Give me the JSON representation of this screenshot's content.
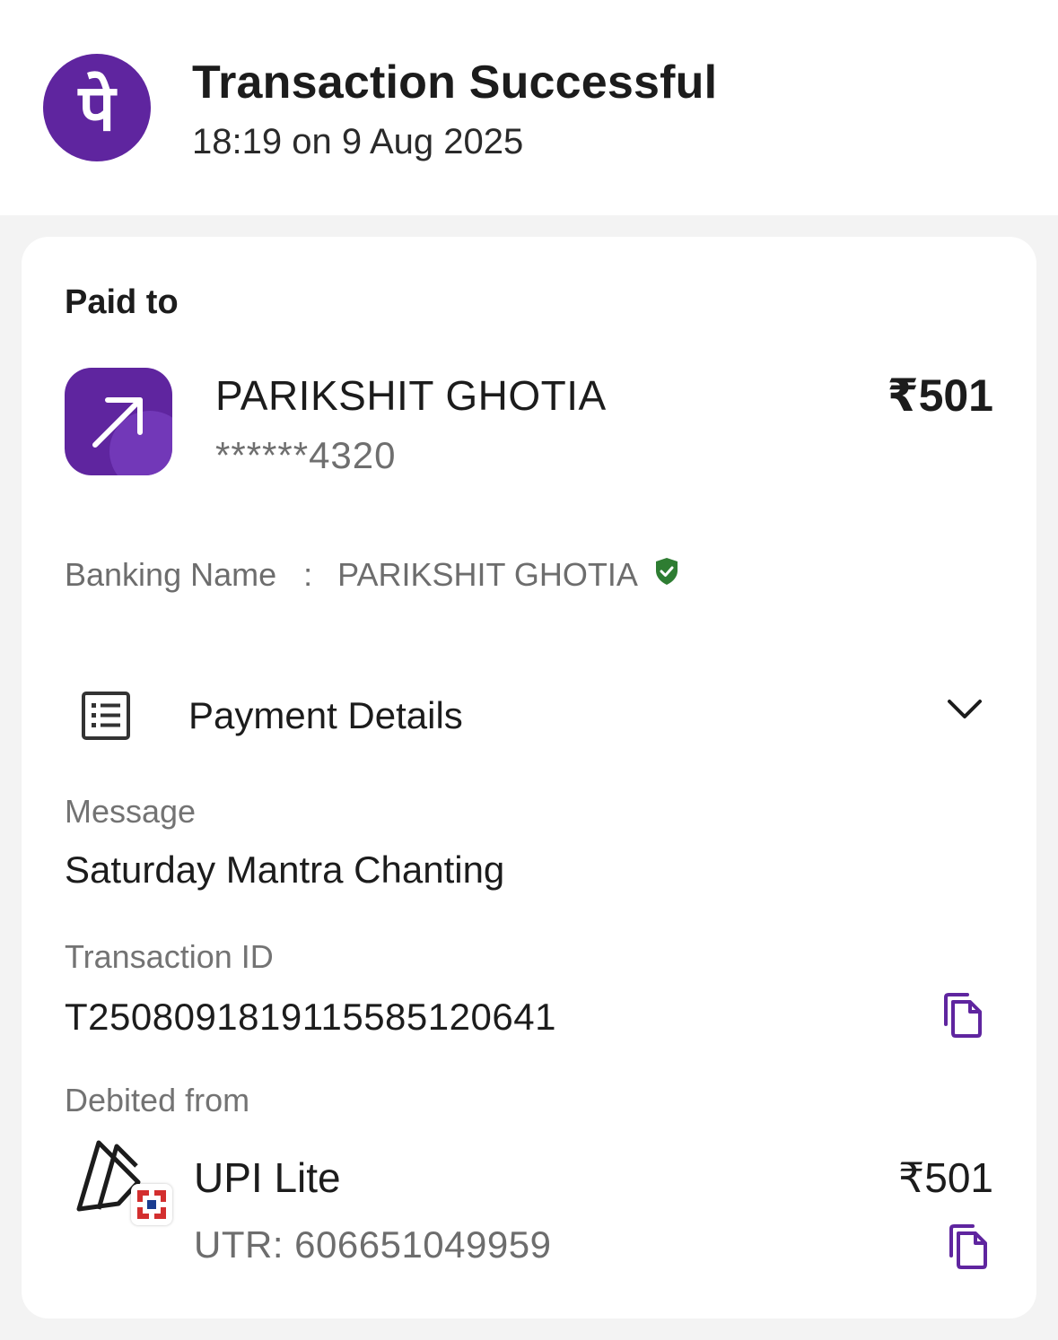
{
  "header": {
    "brand_logo_glyph": "पे",
    "title": "Transaction Successful",
    "timestamp": "18:19 on 9 Aug 2025"
  },
  "payee": {
    "section_label": "Paid to",
    "name": "PARIKSHIT GHOTIA",
    "account": "******4320",
    "amount": "₹501",
    "icon": "arrow-up-right-icon"
  },
  "banking": {
    "label": "Banking Name",
    "separator": ":",
    "value": "PARIKSHIT GHOTIA",
    "verified_icon": "verified-shield-icon"
  },
  "payment_details": {
    "label": "Payment Details",
    "icon": "receipt-list-icon",
    "toggle_icon": "chevron-down-icon"
  },
  "message": {
    "label": "Message",
    "value": "Saturday Mantra Chanting"
  },
  "transaction": {
    "label": "Transaction ID",
    "value": "T2508091819115585120641",
    "copy_icon": "copy-icon"
  },
  "debited": {
    "label": "Debited from",
    "method": "UPI Lite",
    "utr": "UTR: 606651049959",
    "amount": "₹501",
    "copy_icon": "copy-icon"
  },
  "colors": {
    "brand": "#5f259f",
    "verified": "#2e7d32",
    "bank_badge": "#d32f2f",
    "bank_badge_inner": "#1a3c8f"
  }
}
